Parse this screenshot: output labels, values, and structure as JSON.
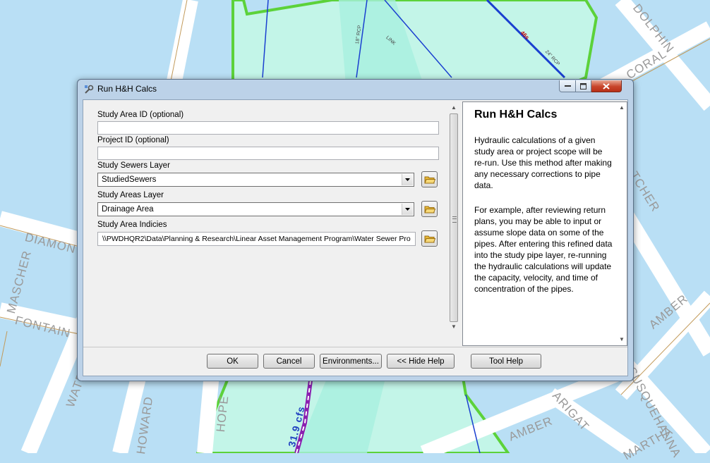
{
  "window": {
    "title": "Run H&H Calcs"
  },
  "params": {
    "study_area_id": {
      "label": "Study Area ID (optional)",
      "value": ""
    },
    "project_id": {
      "label": "Project ID (optional)",
      "value": ""
    },
    "study_sewers_layer": {
      "label": "Study Sewers Layer",
      "value": "StudiedSewers"
    },
    "study_areas_layer": {
      "label": "Study Areas Layer",
      "value": "Drainage Area"
    },
    "study_area_indicies": {
      "label": "Study Area Indicies",
      "value": "\\\\PWDHQR2\\Data\\Planning & Research\\Linear Asset Management Program\\Water Sewer Pro"
    }
  },
  "help": {
    "title": "Run H&H Calcs",
    "paragraph_1": "Hydraulic calculations of a given study area or project scope will be re-run. Use this method after making any necessary corrections to pipe data.",
    "paragraph_2": "For example, after reviewing return plans, you may be able to input or assume slope data on some of the pipes. After entering this refined data into the study pipe layer, re-running the hydraulic calculations will update the capacity, velocity, and time of concentration of the pipes."
  },
  "buttons": {
    "ok": "OK",
    "cancel": "Cancel",
    "environments": "Environments...",
    "hide_help": "<< Hide Help",
    "tool_help": "Tool Help"
  },
  "map": {
    "labels": {
      "diamond": "DIAMON",
      "mascher": "MASCHER",
      "fontain": "FONTAIN",
      "coral": "CORAL",
      "dolphin": "DOLPHIN",
      "amber_1": "AMBER",
      "amber_2": "AMBER",
      "howard": "HOWARD",
      "hope": "HOPE",
      "waterloo": "WATERLO",
      "tcher": "TCHER",
      "arigat": "ARIGAT",
      "martha": "MARTHA",
      "susquehanna": "SUSQUEHANNA",
      "flow": "31.9 cfs",
      "pipe_46": "46s",
      "pipe_rcp": "24\" RCP",
      "pipe_rcp2": "18\" RCP",
      "pipe_link": "LINK"
    }
  },
  "colors": {
    "water": "#b9dff5",
    "area_fill": "#c3f5e8",
    "area_border": "#5cd23a",
    "close_button": "#c8442b"
  }
}
